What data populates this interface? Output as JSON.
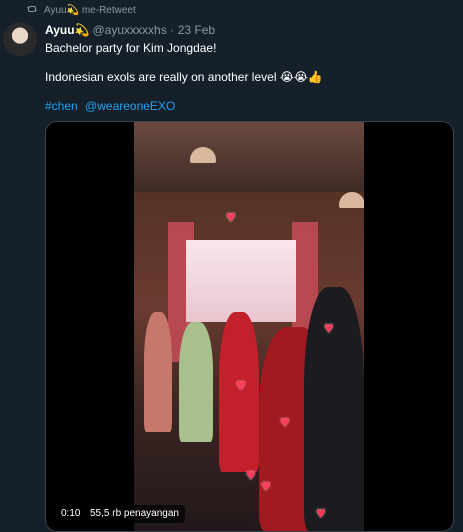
{
  "retweet": {
    "text": "Ayuu💫 me-Retweet"
  },
  "tweet": {
    "name": "Ayuu💫",
    "handle": "@ayuxxxxxhs",
    "separator": "·",
    "date": "23 Feb",
    "line1": "Bachelor party for Kim Jongdae!",
    "line2": "Indonesian exols are really on another level 😭😭👍",
    "hashtags": [
      "#chen",
      "@weareoneEXO"
    ]
  },
  "video": {
    "time": "0:10",
    "views": "55,5 rb penayangan"
  },
  "colors": {
    "background": "#15202b",
    "muted": "#8899a6",
    "link": "#1da1f2",
    "border": "#38444d"
  }
}
